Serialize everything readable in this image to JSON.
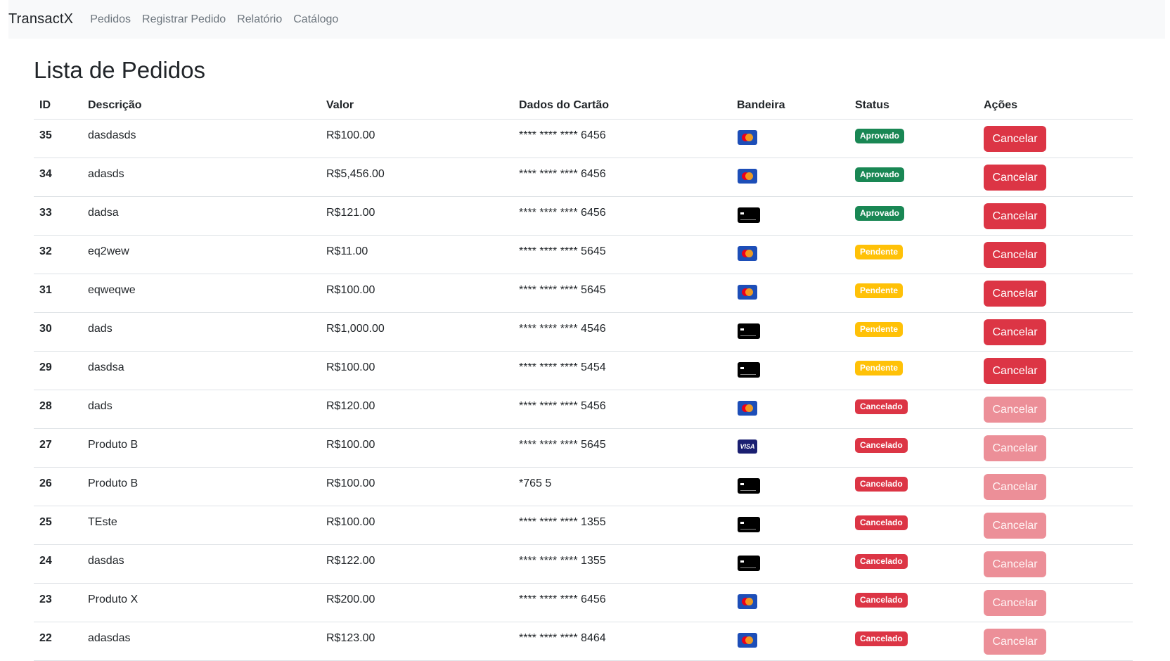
{
  "navbar": {
    "brand": "TransactX",
    "links": [
      "Pedidos",
      "Registrar Pedido",
      "Relatório",
      "Catálogo"
    ]
  },
  "page": {
    "title": "Lista de Pedidos"
  },
  "table": {
    "headers": [
      "ID",
      "Descrição",
      "Valor",
      "Dados do Cartão",
      "Bandeira",
      "Status",
      "Ações"
    ],
    "rows": [
      {
        "id": "35",
        "desc": "dasdasds",
        "valor": "R$100.00",
        "card": "**** **** **** 6456",
        "bandeira": "mastercard",
        "status": "Aprovado",
        "status_type": "approved",
        "action": "Cancelar",
        "action_enabled": true
      },
      {
        "id": "34",
        "desc": "adasds",
        "valor": "R$5,456.00",
        "card": "**** **** **** 6456",
        "bandeira": "mastercard",
        "status": "Aprovado",
        "status_type": "approved",
        "action": "Cancelar",
        "action_enabled": true
      },
      {
        "id": "33",
        "desc": "dadsa",
        "valor": "R$121.00",
        "card": "**** **** **** 6456",
        "bandeira": "generic",
        "status": "Aprovado",
        "status_type": "approved",
        "action": "Cancelar",
        "action_enabled": true
      },
      {
        "id": "32",
        "desc": "eq2wew",
        "valor": "R$11.00",
        "card": "**** **** **** 5645",
        "bandeira": "mastercard",
        "status": "Pendente",
        "status_type": "pending",
        "action": "Cancelar",
        "action_enabled": true
      },
      {
        "id": "31",
        "desc": "eqweqwe",
        "valor": "R$100.00",
        "card": "**** **** **** 5645",
        "bandeira": "mastercard",
        "status": "Pendente",
        "status_type": "pending",
        "action": "Cancelar",
        "action_enabled": true
      },
      {
        "id": "30",
        "desc": "dads",
        "valor": "R$1,000.00",
        "card": "**** **** **** 4546",
        "bandeira": "generic",
        "status": "Pendente",
        "status_type": "pending",
        "action": "Cancelar",
        "action_enabled": true
      },
      {
        "id": "29",
        "desc": "dasdsa",
        "valor": "R$100.00",
        "card": "**** **** **** 5454",
        "bandeira": "generic",
        "status": "Pendente",
        "status_type": "pending",
        "action": "Cancelar",
        "action_enabled": true
      },
      {
        "id": "28",
        "desc": "dads",
        "valor": "R$120.00",
        "card": "**** **** **** 5456",
        "bandeira": "mastercard",
        "status": "Cancelado",
        "status_type": "cancelled",
        "action": "Cancelar",
        "action_enabled": false
      },
      {
        "id": "27",
        "desc": "Produto B",
        "valor": "R$100.00",
        "card": "**** **** **** 5645",
        "bandeira": "visa",
        "status": "Cancelado",
        "status_type": "cancelled",
        "action": "Cancelar",
        "action_enabled": false
      },
      {
        "id": "26",
        "desc": "Produto B",
        "valor": "R$100.00",
        "card": "*765 5",
        "bandeira": "generic",
        "status": "Cancelado",
        "status_type": "cancelled",
        "action": "Cancelar",
        "action_enabled": false
      },
      {
        "id": "25",
        "desc": "TEste",
        "valor": "R$100.00",
        "card": "**** **** **** 1355",
        "bandeira": "generic",
        "status": "Cancelado",
        "status_type": "cancelled",
        "action": "Cancelar",
        "action_enabled": false
      },
      {
        "id": "24",
        "desc": "dasdas",
        "valor": "R$122.00",
        "card": "**** **** **** 1355",
        "bandeira": "generic",
        "status": "Cancelado",
        "status_type": "cancelled",
        "action": "Cancelar",
        "action_enabled": false
      },
      {
        "id": "23",
        "desc": "Produto X",
        "valor": "R$200.00",
        "card": "**** **** **** 6456",
        "bandeira": "mastercard",
        "status": "Cancelado",
        "status_type": "cancelled",
        "action": "Cancelar",
        "action_enabled": false
      },
      {
        "id": "22",
        "desc": "adasdas",
        "valor": "R$123.00",
        "card": "**** **** **** 8464",
        "bandeira": "mastercard",
        "status": "Cancelado",
        "status_type": "cancelled",
        "action": "Cancelar",
        "action_enabled": false
      }
    ]
  },
  "brand_labels": {
    "visa": "VISA"
  },
  "colors": {
    "approved": "#198754",
    "pending": "#ffc107",
    "cancelled": "#dc3545",
    "button": "#dc3545",
    "button_disabled": "#ec8f98"
  }
}
